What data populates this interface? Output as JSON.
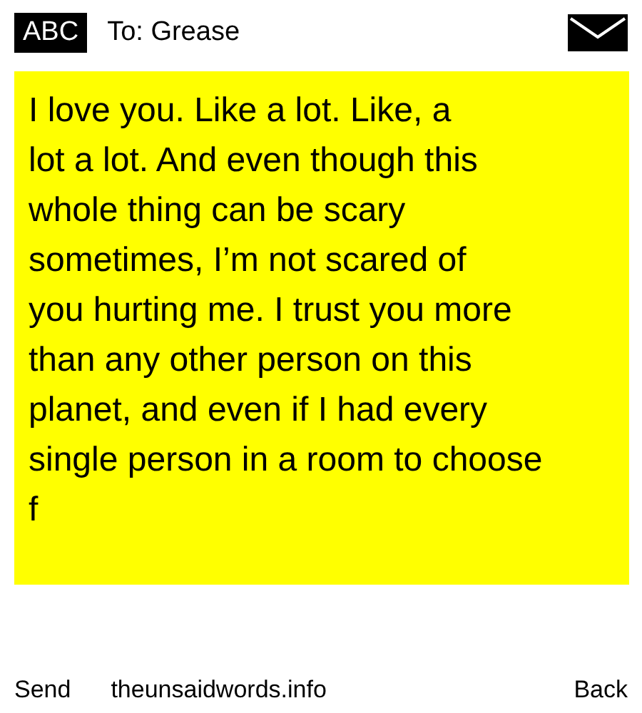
{
  "header": {
    "input_mode": "ABC",
    "recipient": "To: Grease"
  },
  "message": {
    "lines": [
      "I love you. Like a lot. Like, a",
      "lot a lot. And even though this",
      "whole thing can be scary",
      "sometimes, I’m not scared of",
      "you hurting me. I trust you more",
      "than any other person on this",
      "planet, and even if I had every",
      "single person in a room to choose",
      "f"
    ]
  },
  "softkeys": {
    "left": "Send",
    "center": "theunsaidwords.info",
    "right": "Back"
  }
}
